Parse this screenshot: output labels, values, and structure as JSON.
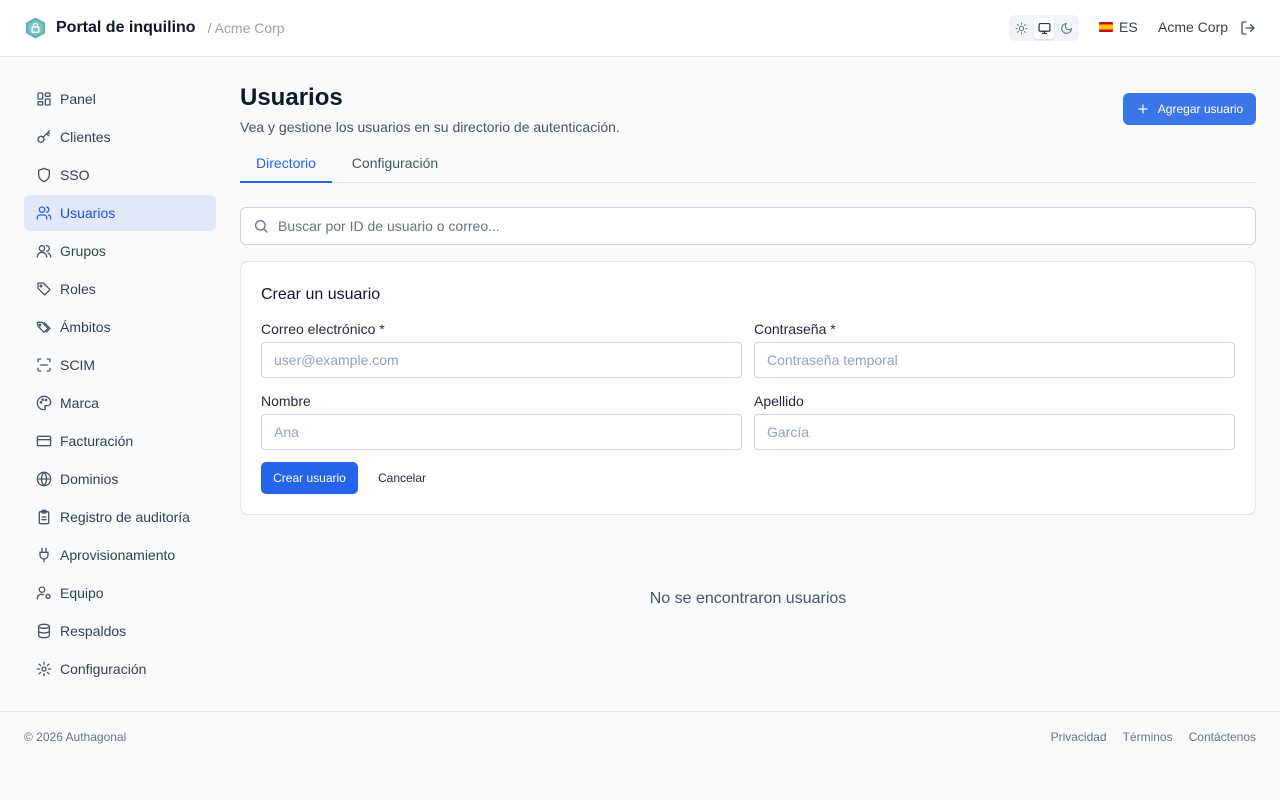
{
  "header": {
    "app_title": "Portal de inquilino",
    "org_breadcrumb": "/ Acme Corp",
    "theme_options": [
      "light-icon",
      "system-icon",
      "dark-icon"
    ],
    "theme_selected": "system",
    "language": "ES",
    "org_name": "Acme Corp"
  },
  "sidebar": {
    "items": [
      {
        "label": "Panel",
        "icon": "dashboard-icon"
      },
      {
        "label": "Clientes",
        "icon": "key-icon"
      },
      {
        "label": "SSO",
        "icon": "shield-icon"
      },
      {
        "label": "Usuarios",
        "icon": "users-icon",
        "active": true
      },
      {
        "label": "Grupos",
        "icon": "group-icon"
      },
      {
        "label": "Roles",
        "icon": "tag-icon"
      },
      {
        "label": "Ámbitos",
        "icon": "tags-icon"
      },
      {
        "label": "SCIM",
        "icon": "scan-icon"
      },
      {
        "label": "Marca",
        "icon": "palette-icon"
      },
      {
        "label": "Facturación",
        "icon": "credit-card-icon"
      },
      {
        "label": "Dominios",
        "icon": "globe-icon"
      },
      {
        "label": "Registro de auditoría",
        "icon": "clipboard-icon"
      },
      {
        "label": "Aprovisionamiento",
        "icon": "plug-icon"
      },
      {
        "label": "Equipo",
        "icon": "user-cog-icon"
      },
      {
        "label": "Respaldos",
        "icon": "database-icon"
      },
      {
        "label": "Configuración",
        "icon": "gear-icon"
      }
    ]
  },
  "main": {
    "title": "Usuarios",
    "description": "Vea y gestione los usuarios en su directorio de autenticación.",
    "add_button": "Agregar usuario",
    "tabs": [
      {
        "label": "Directorio",
        "active": true
      },
      {
        "label": "Configuración",
        "active": false
      }
    ],
    "search": {
      "placeholder": "Buscar por ID de usuario o correo...",
      "value": ""
    },
    "create_form": {
      "title": "Crear un usuario",
      "email": {
        "label": "Correo electrónico *",
        "placeholder": "user@example.com",
        "value": ""
      },
      "password": {
        "label": "Contraseña *",
        "placeholder": "Contraseña temporal",
        "value": ""
      },
      "first_name": {
        "label": "Nombre",
        "placeholder": "Ana",
        "value": ""
      },
      "last_name": {
        "label": "Apellido",
        "placeholder": "García",
        "value": ""
      },
      "submit": "Crear usuario",
      "cancel": "Cancelar"
    },
    "empty_state": "No se encontraron usuarios"
  },
  "footer": {
    "copyright": "© 2026 Authagonal",
    "links": [
      "Privacidad",
      "Términos",
      "Contáctenos"
    ]
  },
  "colors": {
    "accent": "#2563eb",
    "active_nav_bg": "#e2e8f8",
    "logo": "#5fb3b3"
  }
}
